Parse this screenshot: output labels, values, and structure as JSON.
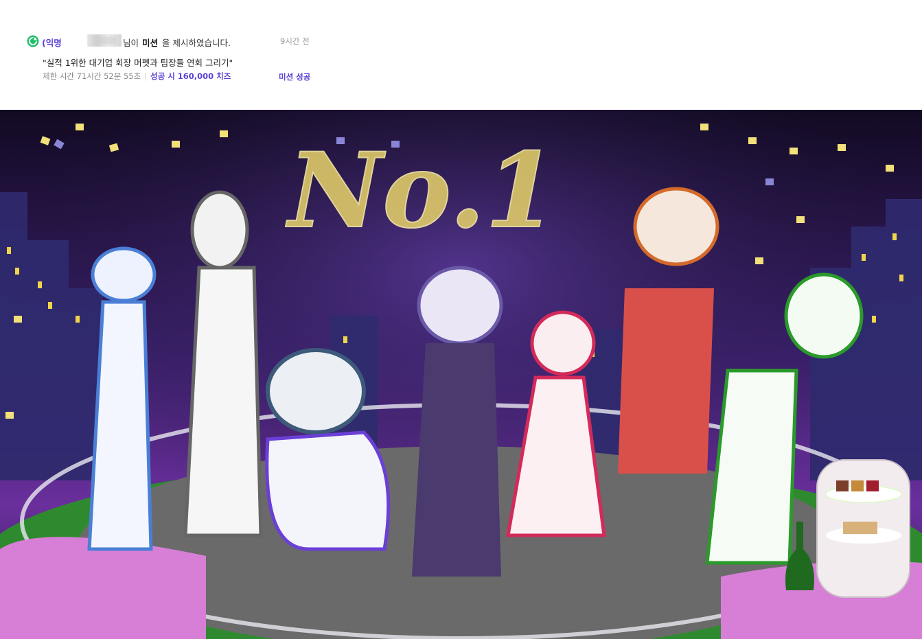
{
  "notice": {
    "user_prefix": "(익명",
    "user_suffix": "님이",
    "action_bold": "미션",
    "action_rest": "을 제시하였습니다.",
    "time_ago": "9시간 전",
    "mission_title": "\"실적 1위한 대기업 회장 머펫과 팀장들 연회 그리기\"",
    "time_limit": "제한 시간 71시간 52분 55초",
    "reward": "성공 시 160,000 치즈",
    "status": "미션 성공"
  },
  "artwork": {
    "sky_text": "No.1",
    "icon": "cheese-badge-icon"
  }
}
